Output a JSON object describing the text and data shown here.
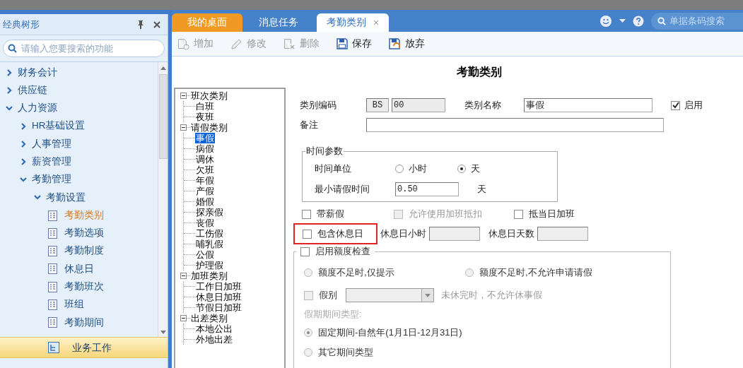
{
  "sidebar": {
    "title": "经典树形",
    "search": {
      "placeholder": "请输入您要搜索的功能"
    },
    "items": [
      {
        "label": "财务会计",
        "expanded": false,
        "selected": false
      },
      {
        "label": "供应链",
        "expanded": false,
        "selected": false
      },
      {
        "label": "人力资源",
        "expanded": true,
        "selected": false,
        "children": [
          {
            "label": "HR基础设置",
            "expanded": false,
            "selected": false
          },
          {
            "label": "人事管理",
            "expanded": false,
            "selected": false
          },
          {
            "label": "薪资管理",
            "expanded": false,
            "selected": false
          },
          {
            "label": "考勤管理",
            "expanded": true,
            "selected": false,
            "children": [
              {
                "label": "考勤设置",
                "expanded": true,
                "selected": false,
                "children": [
                  {
                    "label": "考勤类别",
                    "selected": true
                  },
                  {
                    "label": "考勤选项",
                    "selected": false
                  },
                  {
                    "label": "考勤制度",
                    "selected": false
                  },
                  {
                    "label": "休息日",
                    "selected": false
                  },
                  {
                    "label": "考勤班次",
                    "selected": false
                  },
                  {
                    "label": "班组",
                    "selected": false
                  },
                  {
                    "label": "考勤期间",
                    "selected": false
                  }
                ]
              }
            ]
          }
        ]
      }
    ],
    "bottom_nav": [
      {
        "label": "业务工作",
        "selected": true
      }
    ]
  },
  "tabs": [
    {
      "label": "我的桌面",
      "kind": "home",
      "selected": false
    },
    {
      "label": "消息任务",
      "kind": "normal",
      "selected": false
    },
    {
      "label": "考勤类别",
      "kind": "normal",
      "selected": true,
      "close": "×"
    }
  ],
  "header_search": {
    "placeholder": "单据条码搜索"
  },
  "toolbar": [
    {
      "label": "增加",
      "kind": "add",
      "disabled": true
    },
    {
      "label": "修改",
      "kind": "edit",
      "disabled": true
    },
    {
      "label": "删除",
      "kind": "delete",
      "disabled": true
    },
    {
      "label": "保存",
      "kind": "save",
      "disabled": false
    },
    {
      "label": "放弃",
      "kind": "discard",
      "disabled": false
    }
  ],
  "page_title": "考勤类别",
  "category_tree": [
    {
      "label": "班次类别",
      "expanded": true,
      "selected": false,
      "children": [
        {
          "label": "白班",
          "selected": false
        },
        {
          "label": "夜班",
          "selected": false
        }
      ]
    },
    {
      "label": "请假类别",
      "expanded": true,
      "selected": false,
      "children": [
        {
          "label": "事假",
          "selected": true
        },
        {
          "label": "病假",
          "selected": false
        },
        {
          "label": "调休",
          "selected": false
        },
        {
          "label": "欠班",
          "selected": false
        },
        {
          "label": "年假",
          "selected": false
        },
        {
          "label": "产假",
          "selected": false
        },
        {
          "label": "婚假",
          "selected": false
        },
        {
          "label": "探亲假",
          "selected": false
        },
        {
          "label": "丧假",
          "selected": false
        },
        {
          "label": "工伤假",
          "selected": false
        },
        {
          "label": "哺乳假",
          "selected": false
        },
        {
          "label": "公假",
          "selected": false
        },
        {
          "label": "护理假",
          "selected": false
        }
      ]
    },
    {
      "label": "加班类别",
      "expanded": true,
      "selected": false,
      "children": [
        {
          "label": "工作日加班",
          "selected": false
        },
        {
          "label": "休息日加班",
          "selected": false
        },
        {
          "label": "节假日加班",
          "selected": false
        }
      ]
    },
    {
      "label": "出差类别",
      "expanded": true,
      "selected": false,
      "children": [
        {
          "label": "本地公出",
          "selected": false
        },
        {
          "label": "外地出差",
          "selected": false
        }
      ]
    }
  ],
  "form": {
    "code_label": "类别编码",
    "code_prefix": "BS",
    "code": "00",
    "name_label": "类别名称",
    "name": "事假",
    "enabled": {
      "label": "启用",
      "checked": true
    },
    "remark_label": "备注",
    "time_params": {
      "title": "时间参数",
      "unit_label": "时间单位",
      "units": [
        {
          "label": "小时",
          "selected": false
        },
        {
          "label": "天",
          "selected": true
        }
      ],
      "min_label": "最小请假时间",
      "min_value": "0.50",
      "min_unit": "天"
    },
    "options": [
      {
        "label": "带薪假",
        "checked": false,
        "disabled": false
      },
      {
        "label": "允许使用加班抵扣",
        "checked": false,
        "disabled": true
      },
      {
        "label": "抵当日加班",
        "checked": false,
        "disabled": false
      }
    ],
    "include_rest": {
      "label": "包含休息日",
      "checked": false,
      "highlighted": true
    },
    "rest_hours_label": "休息日小时",
    "rest_days_label": "休息日天数",
    "quota": {
      "label": "启用额度检查",
      "checked": false,
      "modes": [
        {
          "label": "额度不足时,仅提示",
          "selected": false
        },
        {
          "label": "额度不足时,不允许申请请假",
          "selected": false
        }
      ],
      "leave_type": {
        "label": "假别",
        "checked": false,
        "note": "未休完时，不允许休事假"
      },
      "period_label": "假期期间类型:",
      "periods": [
        {
          "label": "固定期间-自然年(1月1日-12月31日)",
          "selected": true
        },
        {
          "label": "其它期间类型",
          "selected": false
        }
      ]
    }
  }
}
